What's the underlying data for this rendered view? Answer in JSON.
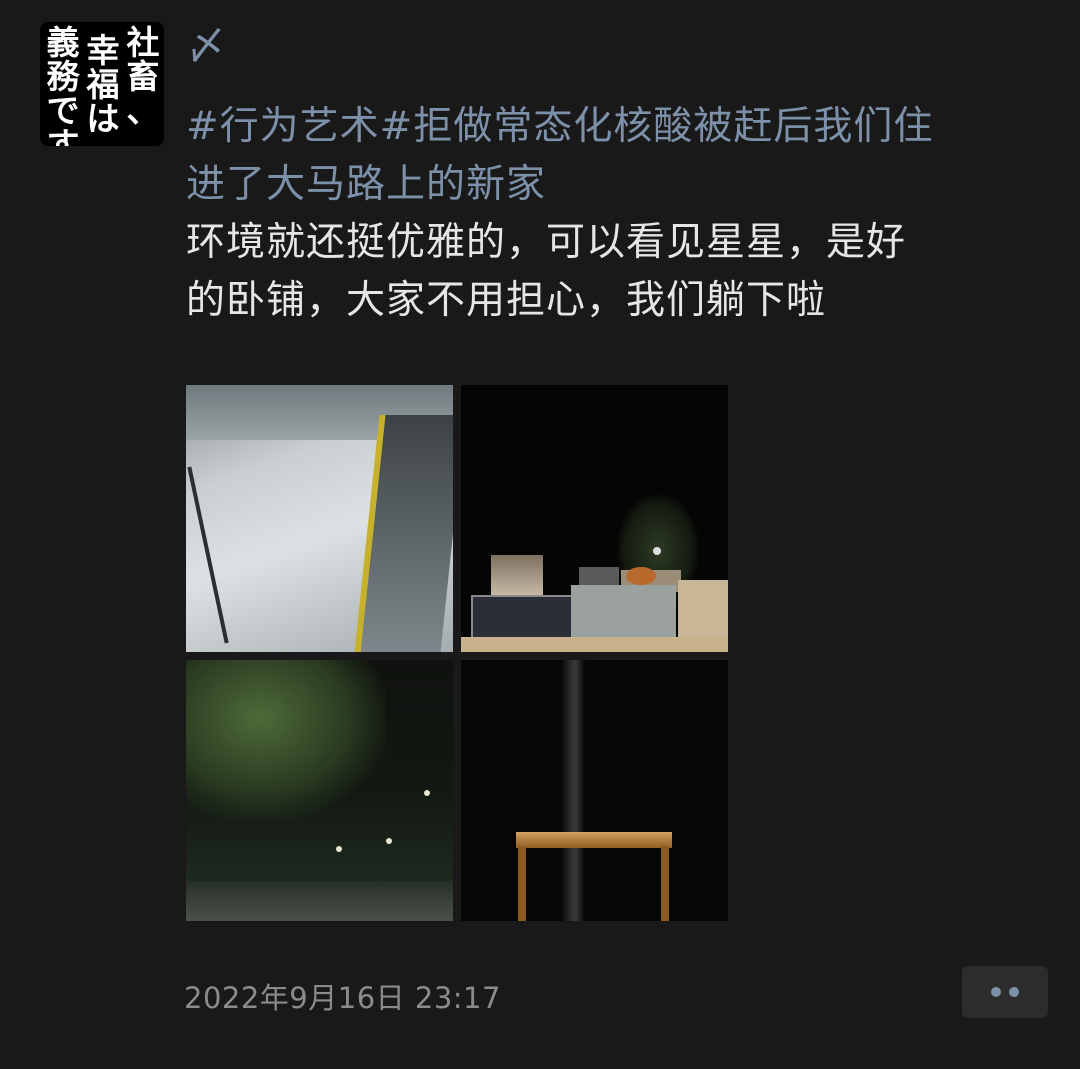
{
  "post": {
    "avatar": {
      "columns": [
        [
          "社",
          "畜",
          "、"
        ],
        [
          "幸",
          "福",
          "は"
        ],
        [
          "義",
          "務",
          "で",
          "す"
        ]
      ]
    },
    "username": "〆",
    "hashtag_lines": [
      "#行为艺术#拒做常态化核酸被赶后我们住",
      "进了大马路上的新家"
    ],
    "body_lines": [
      "环境就还挺优雅的，可以看见星星，是好",
      "的卧铺，大家不用担心，我们躺下啦"
    ],
    "photos": [
      "tent-interior",
      "night-belongings",
      "night-trees",
      "night-table"
    ],
    "timestamp": "2022年9月16日 23:17",
    "more_button": {
      "icon": "more-dots-icon"
    },
    "colors": {
      "background": "#191919",
      "link": "#7d90a9",
      "body_text": "#e6e6e6",
      "timestamp": "#8b8b8b"
    }
  }
}
